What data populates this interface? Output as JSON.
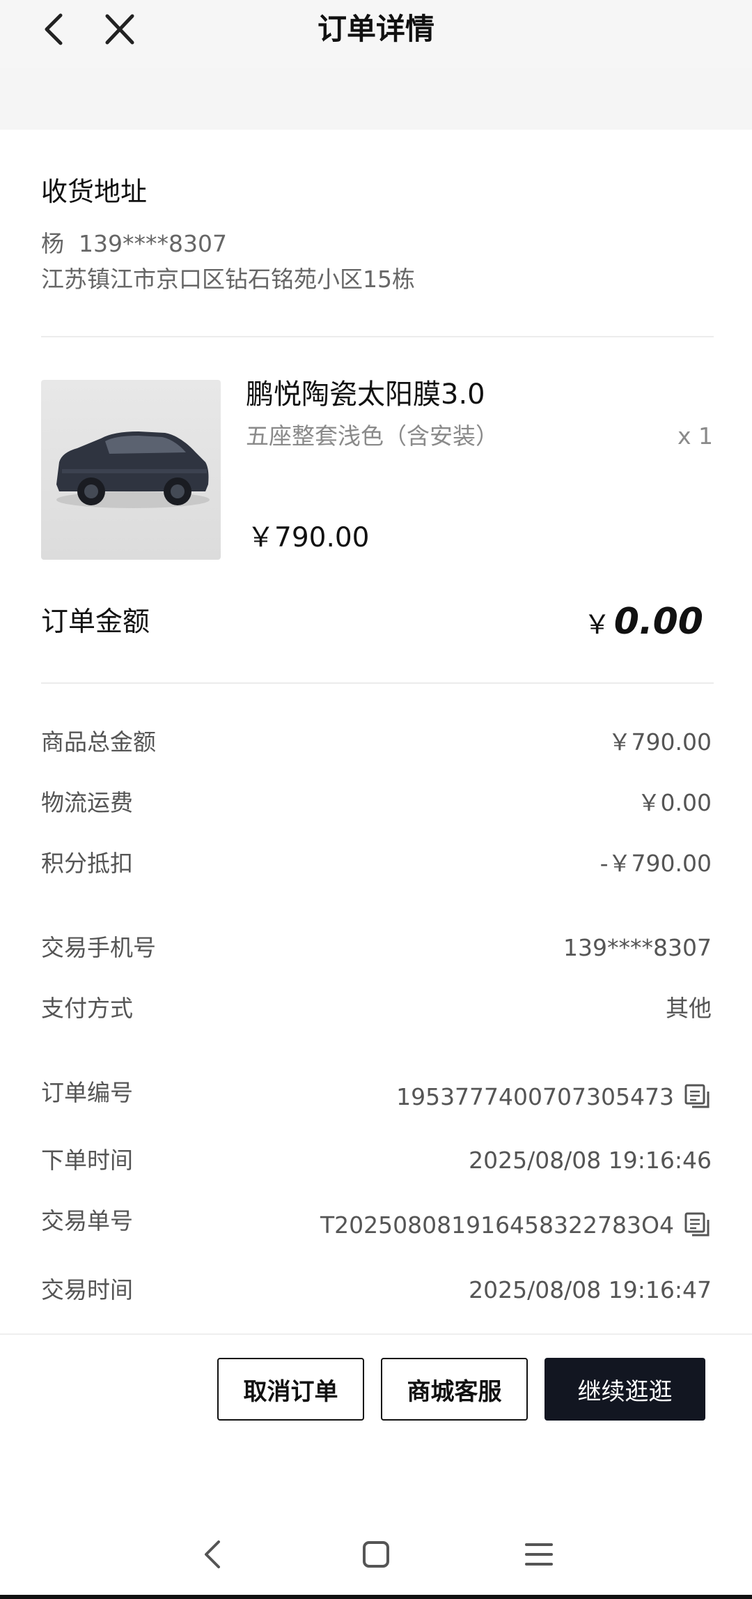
{
  "header": {
    "title": "订单详情",
    "back_icon": "chevron-left-icon",
    "close_icon": "close-icon"
  },
  "address": {
    "title": "收货地址",
    "name_phone": "杨  139****8307",
    "detail": "江苏镇江市京口区钻石铭苑小区15栋"
  },
  "product": {
    "image": "suv-car-image",
    "name": "鹏悦陶瓷太阳膜3.0",
    "spec": "五座整套浅色（含安装）",
    "qty": "x 1",
    "price": "￥790.00"
  },
  "order_amount": {
    "label": "订单金额",
    "currency": "￥",
    "value": "0.00"
  },
  "summary": [
    {
      "label": "商品总金额",
      "value": "￥790.00"
    },
    {
      "label": "物流运费",
      "value": "￥0.00"
    },
    {
      "label": "积分抵扣",
      "value": "-￥790.00"
    }
  ],
  "payment": [
    {
      "label": "交易手机号",
      "value": "139****8307"
    },
    {
      "label": "支付方式",
      "value": "其他"
    }
  ],
  "info": [
    {
      "label": "订单编号",
      "value": "1953777400707305473",
      "copy": true
    },
    {
      "label": "下单时间",
      "value": "2025/08/08 19:16:46",
      "copy": false
    },
    {
      "label": "交易单号",
      "value": "T202508081916458322783O4",
      "copy": true
    },
    {
      "label": "交易时间",
      "value": "2025/08/08 19:16:47",
      "copy": false
    }
  ],
  "actions": {
    "cancel": "取消订单",
    "service": "商城客服",
    "continue": "继续逛逛"
  },
  "colors": {
    "primary_button": "#121621",
    "text_primary": "#111111",
    "text_secondary": "#555555",
    "divider": "#ececec"
  }
}
